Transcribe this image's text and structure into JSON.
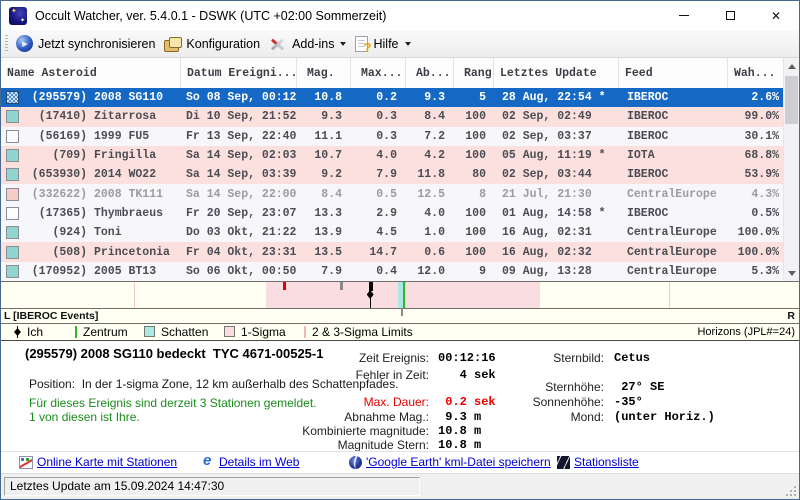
{
  "window": {
    "title": "Occult Watcher, ver. 5.4.0.1 - DSWK (UTC +02:00 Sommerzeit)"
  },
  "toolbar": {
    "sync_label": "Jetzt synchronisieren",
    "config_label": "Konfiguration",
    "addins_label": "Add-ins",
    "help_label": "Hilfe"
  },
  "table": {
    "columns": [
      "Name Asteroid",
      "Datum Ereigni...",
      "Mag.",
      "Max...",
      "Ab...",
      "Rang",
      "Letztes Update",
      "Feed",
      "Wah..."
    ],
    "rows": [
      {
        "num": "(295579)",
        "name": "2008 SG110",
        "datum": "So 08 Sep, 00:12",
        "mag": "10.8",
        "max": "0.2",
        "ab": "9.3",
        "rang": "5",
        "letztes": "28 Aug, 22:54 *",
        "feed": "IBEROC",
        "wah": "2.6%",
        "check": "hatched",
        "style": "selected",
        "dim": false
      },
      {
        "num": "(17410)",
        "name": "Zitarrosa",
        "datum": "Di 10 Sep, 21:52",
        "mag": "9.3",
        "max": "0.3",
        "ab": "8.4",
        "rang": "100",
        "letztes": "02 Sep, 02:49",
        "feed": "IBEROC",
        "wah": "99.0%",
        "check": "teal",
        "style": "pink",
        "dim": false
      },
      {
        "num": "(56169)",
        "name": "1999 FU5",
        "datum": "Fr 13 Sep, 22:40",
        "mag": "11.1",
        "max": "0.3",
        "ab": "7.2",
        "rang": "100",
        "letztes": "02 Sep, 03:37",
        "feed": "IBEROC",
        "wah": "30.1%",
        "check": "empty",
        "style": "light",
        "dim": false
      },
      {
        "num": "(709)",
        "name": "Fringilla",
        "datum": "Sa 14 Sep, 02:03",
        "mag": "10.7",
        "max": "4.0",
        "ab": "4.2",
        "rang": "100",
        "letztes": "05 Aug, 11:19 *",
        "feed": "IOTA",
        "wah": "68.8%",
        "check": "teal",
        "style": "pink",
        "dim": false
      },
      {
        "num": "(653930)",
        "name": "2014 WO22",
        "datum": "Sa 14 Sep, 03:39",
        "mag": "9.2",
        "max": "7.9",
        "ab": "11.8",
        "rang": "80",
        "letztes": "02 Sep, 03:44",
        "feed": "IBEROC",
        "wah": "53.9%",
        "check": "teal",
        "style": "pink",
        "dim": false
      },
      {
        "num": "(332622)",
        "name": "2008 TK111",
        "datum": "Sa 14 Sep, 22:00",
        "mag": "8.4",
        "max": "0.5",
        "ab": "12.5",
        "rang": "8",
        "letztes": "21 Jul, 21:30",
        "feed": "CentralEurope",
        "wah": "4.3%",
        "check": "pinkbox",
        "style": "light",
        "dim": true
      },
      {
        "num": "(17365)",
        "name": "Thymbraeus",
        "datum": "Fr 20 Sep, 23:07",
        "mag": "13.3",
        "max": "2.9",
        "ab": "4.0",
        "rang": "100",
        "letztes": "01 Aug, 14:58 *",
        "feed": "IBEROC",
        "wah": "0.5%",
        "check": "empty",
        "style": "light",
        "dim": false
      },
      {
        "num": "(924)",
        "name": "Toni",
        "datum": "Do 03 Okt, 21:22",
        "mag": "13.9",
        "max": "4.5",
        "ab": "1.0",
        "rang": "100",
        "letztes": "16 Aug, 02:31",
        "feed": "CentralEurope",
        "wah": "100.0%",
        "check": "teal",
        "style": "light",
        "dim": false
      },
      {
        "num": "(508)",
        "name": "Princetonia",
        "datum": "Fr 04 Okt, 23:31",
        "mag": "13.5",
        "max": "14.7",
        "ab": "0.6",
        "rang": "100",
        "letztes": "16 Aug, 02:32",
        "feed": "CentralEurope",
        "wah": "100.0%",
        "check": "teal",
        "style": "pink",
        "dim": false
      },
      {
        "num": "(170952)",
        "name": "2005 BT13",
        "datum": "So 06 Okt, 00:50",
        "mag": "7.9",
        "max": "0.4",
        "ab": "12.0",
        "rang": "9",
        "letztes": "09 Aug, 13:28",
        "feed": "CentralEurope",
        "wah": "5.3%",
        "check": "teal",
        "style": "light",
        "dim": false
      }
    ]
  },
  "timeline": {
    "left_label": "L [IBEROC Events]",
    "right_label": "R",
    "markers": [
      {
        "type": "limit-line",
        "x": 16.7
      },
      {
        "type": "sigma1-band",
        "x": 33.2,
        "w": 34.3
      },
      {
        "type": "limit-line",
        "x": 83.7
      },
      {
        "type": "red-tick",
        "x": 35.4
      },
      {
        "type": "gray-tick",
        "x": 42.5
      },
      {
        "type": "ich",
        "x": 46.2
      },
      {
        "type": "shadow-band",
        "x": 49.7,
        "w": 1.1
      },
      {
        "type": "center-line",
        "x": 50.4
      }
    ]
  },
  "legend": {
    "items": [
      {
        "label": "Ich"
      },
      {
        "label": "Zentrum"
      },
      {
        "label": "Schatten"
      },
      {
        "label": "1-Sigma"
      },
      {
        "label": "2 & 3-Sigma Limits"
      }
    ],
    "right_label": "Horizons (JPL#=24)"
  },
  "details": {
    "title": "(295579) 2008 SG110 bedeckt  TYC 4671-00525-1",
    "position_line": "Position:  In der 1-sigma Zone, 12 km außerhalb des Schattenpfades.",
    "stations_line1": "Für dieses Ereignis sind derzeit 3 Stationen gemeldet.",
    "stations_line2": "1 von diesen ist Ihre.",
    "fields": [
      {
        "label": "Zeit Ereignis:",
        "value": "00:12:16"
      },
      {
        "label": "Fehler in Zeit:",
        "value": "   4 sek"
      },
      {
        "label": "Max. Dauer:",
        "value": " 0.2 sek"
      },
      {
        "label": "Abnahme Mag.:",
        "value": " 9.3 m"
      },
      {
        "label": "Kombinierte magnitude:",
        "value": "10.8 m"
      },
      {
        "label": "Magnitude Stern:",
        "value": "10.8 m"
      }
    ],
    "right_fields": [
      {
        "label": "Sternbild:",
        "value": "Cetus"
      },
      {
        "label": "Sternhöhe:",
        "value": " 27° SE"
      },
      {
        "label": "Sonnenhöhe:",
        "value": "-35°"
      },
      {
        "label": "Mond:",
        "value": "(unter Horiz.)"
      }
    ]
  },
  "links": [
    {
      "label": "Online Karte mit Stationen"
    },
    {
      "label": "Details im Web"
    },
    {
      "label": "'Google Earth' kml-Datei speichern"
    },
    {
      "label": "Stationsliste"
    }
  ],
  "statusbar": {
    "text": "Letztes Update am 15.09.2024 14:47:30"
  },
  "colors": {
    "selected_row": "#1568c4",
    "row_pink": "#fbe0dd",
    "row_light": "#f6f6fb",
    "shadow_cyan": "#a9e9e3",
    "sigma_pink": "#fadde0",
    "center_green": "#35b435",
    "link_blue": "#0000d4"
  }
}
